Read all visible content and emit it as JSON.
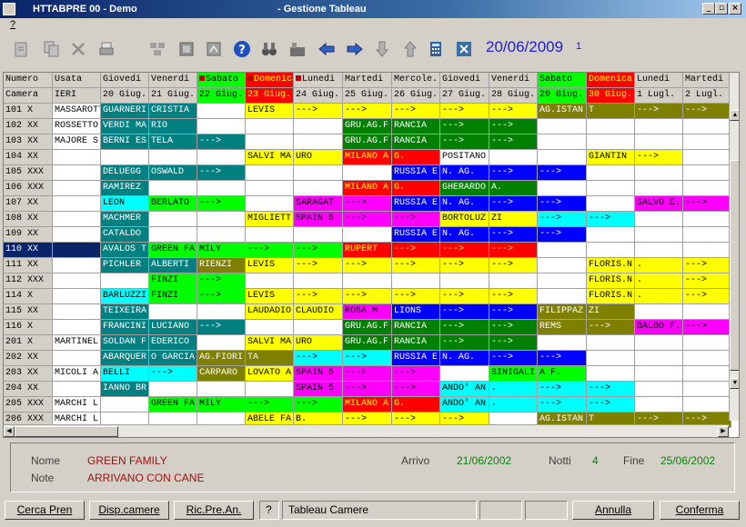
{
  "window": {
    "title": "HTTABPRE 00 - Demo",
    "subtitle": "- Gestione Tableau",
    "menu": "?"
  },
  "toolbar": {
    "date": "20/06/2009",
    "counter": "1",
    "icons": [
      "new-doc-icon",
      "copy-doc-icon",
      "delete-x-icon",
      "print-icon",
      "grid-a-icon",
      "grid-b-icon",
      "grid-c-icon",
      "help-icon",
      "binoculars-icon",
      "office-icon",
      "arrow-left-icon",
      "arrow-right-icon",
      "arrow-down-icon",
      "arrow-up-icon",
      "calculator-icon",
      "close-icon"
    ]
  },
  "palette": {
    "Y": "#ffff00",
    "G": "#008000",
    "T": "#008080",
    "L": "#00ff00",
    "C": "#00ffff",
    "M": "#ff00ff",
    "R": "#ff0000",
    "B": "#0000ff",
    "O": "#808000",
    "W": "#ffffff",
    "N": "#0a246a",
    "H": "#d4d0c8"
  },
  "header": {
    "row1": [
      "Numero",
      "Usata",
      "Giovedi",
      "Venerdi",
      "Sabato",
      "Domenica",
      "Lunedi",
      "Martedi",
      "Mercole.",
      "Giovedi",
      "Venerdi",
      "Sabato",
      "Domenica",
      "Lunedi",
      "Martedi"
    ],
    "row2": [
      "Camera",
      "IERI",
      "20 Giug.",
      "21 Giug.",
      "22 Giug.",
      "23 Giug.",
      "24 Giug.",
      "25 Giug.",
      "26 Giug.",
      "27 Giug.",
      "28 Giug.",
      "29 Giug.",
      "30 Giug.",
      "1 Lugl.",
      "2 Lugl."
    ],
    "styles": [
      "H",
      "H",
      "H",
      "H",
      "L",
      "R",
      "H",
      "H",
      "H",
      "H",
      "H",
      "L",
      "R",
      "H",
      "H"
    ],
    "flag_cols": [
      4,
      5,
      6
    ]
  },
  "rows": [
    {
      "c": [
        "101 X",
        "MASSAROTT",
        "GUARNERI",
        "CRISTIA",
        "",
        "LEVIS",
        "--->",
        "--->",
        "--->",
        "--->",
        "--->",
        "AG.ISTAN",
        "T",
        "--->",
        "--->"
      ],
      "s": "HWTTWYYYYYYOOOO"
    },
    {
      "c": [
        "102 XX",
        "ROSSETTO",
        "VERDI MA",
        "RIO",
        "",
        "",
        "",
        "GRU.AG.F",
        "RANCIA",
        "--->",
        "--->",
        "",
        "",
        "",
        ""
      ],
      "s": "HWTTWWWGGGGWWWW"
    },
    {
      "c": [
        "103 XX",
        "MAJORE S",
        "BERNI ES",
        "TELA",
        "--->",
        "",
        "",
        "GRU.AG.F",
        "RANCIA",
        "--->",
        "--->",
        "",
        "",
        "",
        ""
      ],
      "s": "HWTTTWWGGGGWWWW"
    },
    {
      "c": [
        "104 XX",
        "",
        "",
        "",
        "",
        "SALVI MA",
        "URO",
        "MILANO A",
        "G.",
        "POSITANO",
        "",
        "",
        "GIANTIN",
        "--->",
        ""
      ],
      "s": "HWWWWYYRRWWWYYW"
    },
    {
      "c": [
        "105 XXX",
        "",
        "DELUEGG",
        "OSWALD",
        "--->",
        "",
        "",
        "",
        "RUSSIA E",
        "N. AG.",
        "--->",
        "--->",
        "",
        "",
        ""
      ],
      "s": "HWTTTWWWBBBBWWW"
    },
    {
      "c": [
        "106 XXX",
        "",
        "RAMIREZ",
        "",
        "",
        "",
        "",
        "MILANO A",
        "G.",
        "GHERARDO",
        "A.",
        "",
        "",
        "",
        ""
      ],
      "s": "HWTWWWWRRGGWWWW"
    },
    {
      "c": [
        "107 XX",
        "",
        "LEON",
        "BERLATO",
        "--->",
        "",
        "SARAGAT",
        "--->",
        "RUSSIA E",
        "N. AG.",
        "--->",
        "--->",
        "",
        "SALVO E.",
        "--->"
      ],
      "s": "HWCLLWMMBBBBWMM"
    },
    {
      "c": [
        "108 XX",
        "",
        "MACHMER",
        "",
        "",
        "MIGLIETT",
        "SPAIN 5",
        "--->",
        "--->",
        "BORTOLUZ",
        "ZI",
        "--->",
        "--->",
        "",
        ""
      ],
      "s": "HWTWWYMMMYYCCWW"
    },
    {
      "c": [
        "109 XX",
        "",
        "CATALDO",
        "",
        "",
        "",
        "",
        "",
        "RUSSIA E",
        "N. AG.",
        "--->",
        "--->",
        "",
        "",
        ""
      ],
      "s": "HWTWWWWWBBBBWWW"
    },
    {
      "c": [
        "110 XX",
        "",
        "AVALOS T",
        "GREEN FA",
        "MILY",
        "--->",
        "--->",
        "RUPERT",
        "--->",
        "--->",
        "--->",
        "",
        "",
        "",
        ""
      ],
      "s": "NNTLLLLRRRRWWWW"
    },
    {
      "c": [
        "111 XX",
        "",
        "PICHLER",
        "ALBERTI",
        "RIENZI",
        "LEVIS",
        "--->",
        "--->",
        "--->",
        "--->",
        "--->",
        "",
        "FLORIS.N",
        ".",
        "--->"
      ],
      "s": "HWTTOYYYYYYWYYY"
    },
    {
      "c": [
        "112 XXX",
        "",
        "",
        "FINZI",
        "--->",
        "",
        "",
        "",
        "",
        "",
        "",
        "",
        "FLORIS.N",
        ".",
        "--->"
      ],
      "s": "HWWLLWWWWWWWYYY"
    },
    {
      "c": [
        "114 X",
        "",
        "BARLUZZI",
        "FINZI",
        "--->",
        "LEVIS",
        "--->",
        "--->",
        "--->",
        "--->",
        "--->",
        "",
        "FLORIS.N",
        ".",
        "--->"
      ],
      "s": "HWCLLYYYYYYWYYY"
    },
    {
      "c": [
        "115 XX",
        "",
        "TEIXEIRA",
        "",
        "",
        "LAUDADIO",
        "CLAUDIO",
        "ROSA M",
        "LIONS",
        "--->",
        "--->",
        "FILIPPAZ",
        "ZI",
        "",
        ""
      ],
      "s": "HWTWWYYMBBBOOWW"
    },
    {
      "c": [
        "116 X",
        "",
        "FRANCINI",
        "LUCIANO",
        "--->",
        "",
        "",
        "GRU.AG.F",
        "RANCIA",
        "--->",
        "--->",
        "REMS",
        "--->",
        "BALBO F.",
        "--->"
      ],
      "s": "HWTTTWWGGGGOOMM"
    },
    {
      "c": [
        "201 X",
        "MARTINEL",
        "SOLDAN F",
        "EDERICO",
        "",
        "SALVI MA",
        "URO",
        "GRU.AG.F",
        "RANCIA",
        "--->",
        "--->",
        "",
        "",
        "",
        ""
      ],
      "s": "HWTTWYYGGGGWWWW"
    },
    {
      "c": [
        "202 XX",
        "",
        "ABARQUER",
        "O GARCIA",
        "AG.FIORI",
        "TA",
        "--->",
        "--->",
        "RUSSIA E",
        "N. AG.",
        "--->",
        "--->",
        "",
        "",
        ""
      ],
      "s": "HWTTOOCCBBBBWWW"
    },
    {
      "c": [
        "203 XX",
        "MICOLI A",
        "BELLI",
        "--->",
        "CARPARO",
        "LOVATO A",
        "SPAIN 5",
        "--->",
        "--->",
        "",
        "SINIGALI",
        "A F.",
        "",
        "",
        ""
      ],
      "s": "HWCCOYMMMWLLWWW"
    },
    {
      "c": [
        "204 XX",
        "",
        "IANNO BR",
        "",
        "",
        "",
        "SPAIN 5",
        "--->",
        "--->",
        "ANDO' AN",
        ".",
        "--->",
        "--->",
        "",
        ""
      ],
      "s": "HWTWWWMMMCCCCWW"
    },
    {
      "c": [
        "205 XXX",
        "MARCHI L",
        "",
        "GREEN FA",
        "MILY",
        "--->",
        "--->",
        "MILANO A",
        "G.",
        "ANDO' AN",
        ".",
        "--->",
        "--->",
        "",
        ""
      ],
      "s": "HWWLLLLRRCCCCWW"
    },
    {
      "c": [
        "206 XXX",
        "MARCHI L",
        "",
        "",
        "",
        "ABELE FA",
        "B.",
        "--->",
        "--->",
        "--->",
        "",
        "AG.ISTAN",
        "T",
        "--->",
        "--->"
      ],
      "s": "HWWWWYYYYYWOOOO"
    }
  ],
  "info": {
    "nome_label": "Nome",
    "nome": "GREEN FAMILY",
    "note_label": "Note",
    "note": "ARRIVANO CON CANE",
    "arrivo_label": "Arrivo",
    "arrivo": "21/06/2002",
    "notti_label": "Notti",
    "notti": "4",
    "fine_label": "Fine",
    "fine": "25/06/2002"
  },
  "buttons": {
    "cerca": "Cerca Pren",
    "disp": "Disp.camere",
    "ric": "Ric.Pre.An.",
    "q": "?",
    "status": "Tableau Camere",
    "annulla": "Annulla",
    "conferma": "Conferma"
  }
}
